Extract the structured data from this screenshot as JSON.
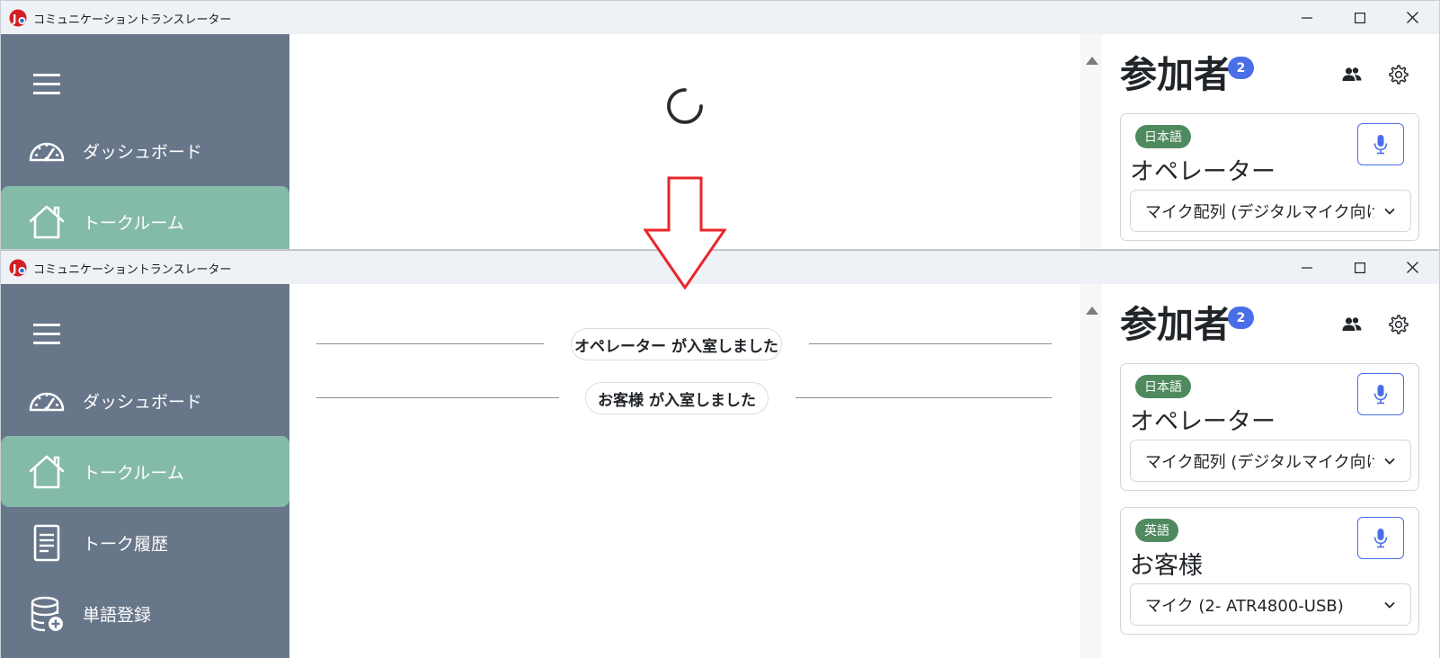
{
  "app": {
    "title": "コミュニケーショントランスレーター"
  },
  "window_controls": {
    "minimize_icon": "minimize-icon",
    "maximize_icon": "maximize-icon",
    "close_icon": "close-icon"
  },
  "nav": {
    "menu_icon": "hamburger-icon",
    "items": [
      {
        "label": "ダッシュボード",
        "icon": "speedometer-icon"
      },
      {
        "label": "トークルーム",
        "icon": "house-icon"
      },
      {
        "label": "トーク履歴",
        "icon": "document-icon"
      },
      {
        "label": "単語登録",
        "icon": "database-add-icon"
      }
    ],
    "active_index": 1
  },
  "chat": {
    "loading_icon": "spinner-icon",
    "messages": [
      {
        "text": "オペレーター が入室しました"
      },
      {
        "text": "お客様 が入室しました"
      }
    ]
  },
  "participants_panel": {
    "title": "参加者",
    "count": "2",
    "icons": [
      "people-icon",
      "gear-icon"
    ],
    "cards": [
      {
        "language": "日本語",
        "name": "オペレーター",
        "device": "マイク配列 (デジタルマイク向けインテル® スマート・サウンド・テクノロジー)",
        "mic_icon": "microphone-icon"
      },
      {
        "language": "英語",
        "name": "お客様",
        "device": "マイク (2- ATR4800-USB)",
        "mic_icon": "microphone-icon"
      }
    ]
  },
  "colors": {
    "sidebar": "#68768a",
    "sidebar_active": "#84bba8",
    "accent": "#4a6ee8",
    "language_badge": "#4f8a5e",
    "arrow": "#e8262b"
  },
  "annotation": {
    "arrow_icon": "down-arrow-icon"
  }
}
